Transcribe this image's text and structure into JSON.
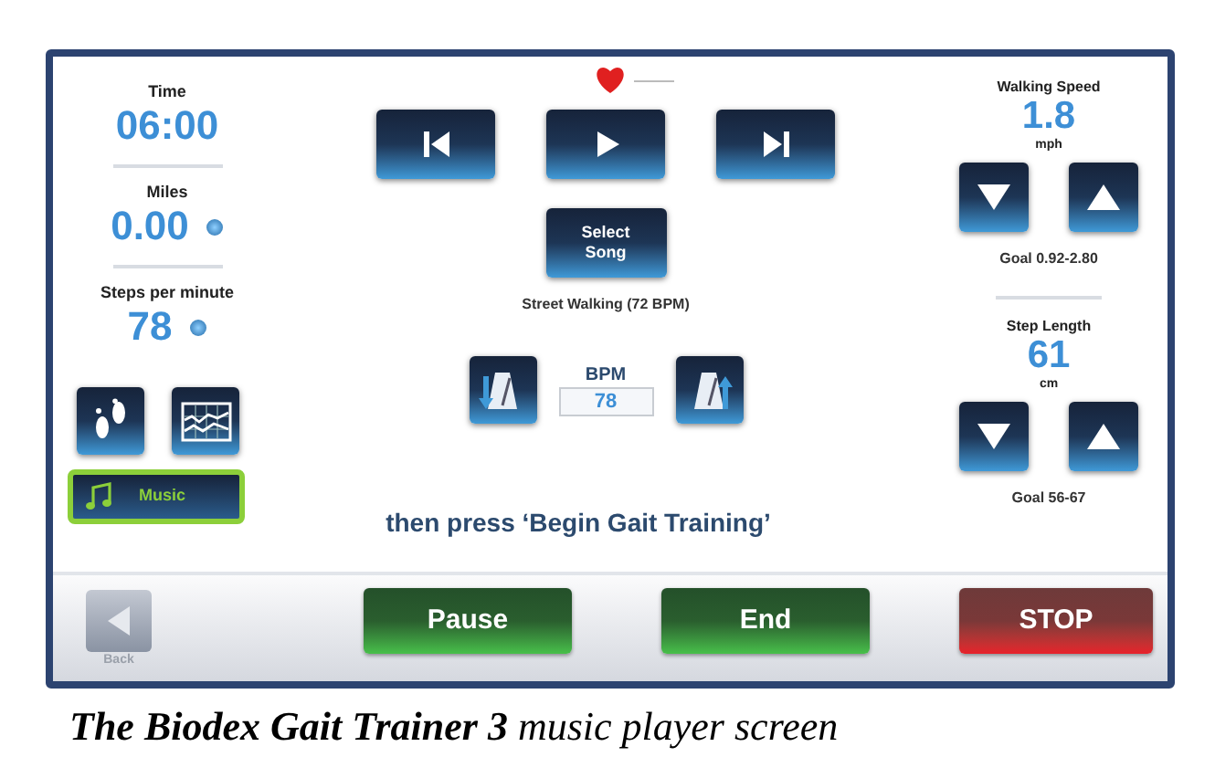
{
  "left_metrics": [
    {
      "label": "Time",
      "value": "06:00",
      "indicator": false
    },
    {
      "label": "Miles",
      "value": "0.00",
      "indicator": true
    },
    {
      "label": "Steps per minute",
      "value": "78",
      "indicator": true
    }
  ],
  "view_buttons": [
    {
      "kind": "footsteps"
    },
    {
      "kind": "graph"
    }
  ],
  "music_button": {
    "label": "Music",
    "selected": true
  },
  "transport": [
    {
      "kind": "previous"
    },
    {
      "kind": "play"
    },
    {
      "kind": "next"
    }
  ],
  "select_song": "Select Song",
  "song": "Street Walking (72 BPM)",
  "bpm": {
    "label": "BPM",
    "value": "78"
  },
  "instruction": "then press ‘Begin Gait Training’",
  "right_metrics": [
    {
      "label": "Walking Speed",
      "value": "1.8",
      "unit": "mph",
      "goal": "Goal 0.92-2.80"
    },
    {
      "label": "Step Length",
      "value": "61",
      "unit": "cm",
      "goal": "Goal 56-67"
    }
  ],
  "back": {
    "label": "Back",
    "disabled": true
  },
  "actions": [
    {
      "label": "Pause",
      "kind": "go"
    },
    {
      "label": "End",
      "kind": "go"
    },
    {
      "label": "STOP",
      "kind": "stop"
    }
  ],
  "caption": "**The Biodex Gait Trainer 3** music player screen"
}
